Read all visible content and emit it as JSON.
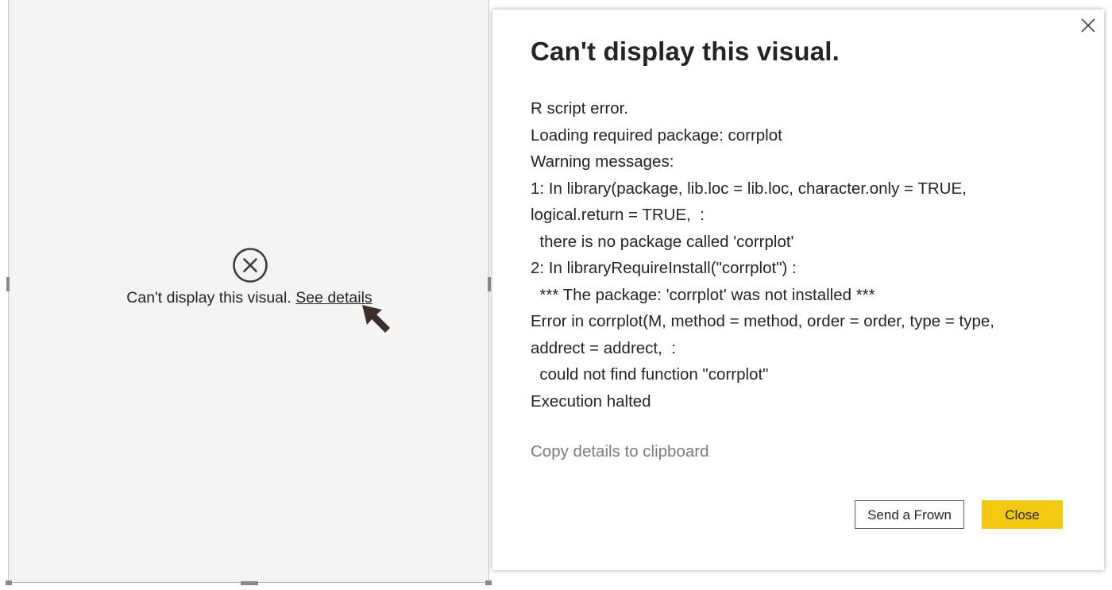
{
  "visual": {
    "error_message": "Can't display this visual.",
    "see_details_link": "See details"
  },
  "dialog": {
    "title": "Can't display this visual.",
    "details_lines": [
      "R script error.",
      "Loading required package: corrplot",
      "Warning messages:",
      "1: In library(package, lib.loc = lib.loc, character.only = TRUE,",
      "logical.return = TRUE,  :",
      "  there is no package called 'corrplot'",
      "2: In libraryRequireInstall(\"corrplot\") :",
      "  *** The package: 'corrplot' was not installed ***",
      "Error in corrplot(M, method = method, order = order, type = type,",
      "addrect = addrect,  :",
      "  could not find function \"corrplot\"",
      "Execution halted"
    ],
    "copy_link": "Copy details to clipboard",
    "send_frown_label": "Send a Frown",
    "close_label": "Close"
  },
  "icons": {
    "error": "error-circle-icon",
    "close": "close-icon",
    "cursor": "mouse-pointer-icon"
  },
  "colors": {
    "accent_yellow": "#F2C811",
    "text_dark": "#252423",
    "link_gray": "#7B7B7B",
    "visual_background": "#F3F3F3"
  }
}
